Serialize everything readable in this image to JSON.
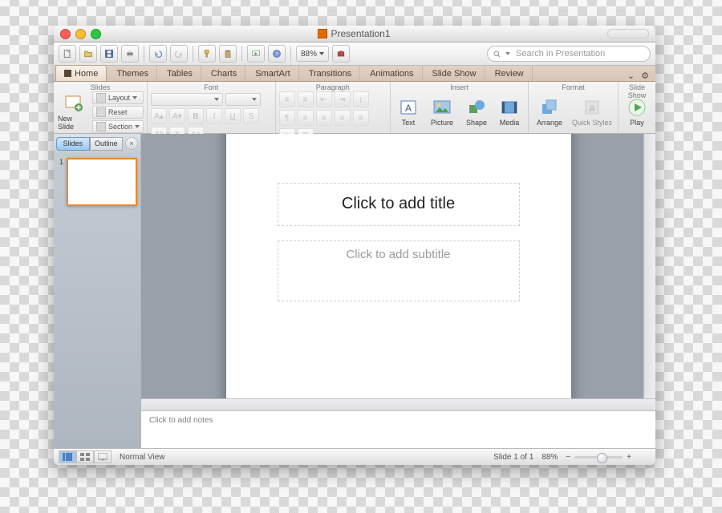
{
  "window": {
    "title": "Presentation1"
  },
  "quickbar": {
    "zoom": "88%",
    "search_placeholder": "Search in Presentation"
  },
  "tabs": {
    "home": "Home",
    "themes": "Themes",
    "tables": "Tables",
    "charts": "Charts",
    "smartart": "SmartArt",
    "transitions": "Transitions",
    "animations": "Animations",
    "slideshow": "Slide Show",
    "review": "Review"
  },
  "ribbon": {
    "slides": {
      "title": "Slides",
      "new_slide": "New Slide",
      "layout": "Layout",
      "reset": "Reset",
      "section": "Section"
    },
    "font": {
      "title": "Font"
    },
    "paragraph": {
      "title": "Paragraph"
    },
    "insert": {
      "title": "Insert",
      "text": "Text",
      "picture": "Picture",
      "shape": "Shape",
      "media": "Media"
    },
    "format": {
      "title": "Format",
      "arrange": "Arrange",
      "quick_styles": "Quick Styles"
    },
    "slideshow": {
      "title": "Slide Show",
      "play": "Play"
    }
  },
  "sidebar": {
    "tabs": {
      "slides": "Slides",
      "outline": "Outline"
    },
    "thumbs": [
      {
        "num": "1"
      }
    ]
  },
  "slide": {
    "title_ph": "Click to add title",
    "subtitle_ph": "Click to add subtitle"
  },
  "notes": {
    "placeholder": "Click to add notes"
  },
  "status": {
    "view": "Normal View",
    "slide": "Slide 1 of 1",
    "zoom": "88%"
  }
}
